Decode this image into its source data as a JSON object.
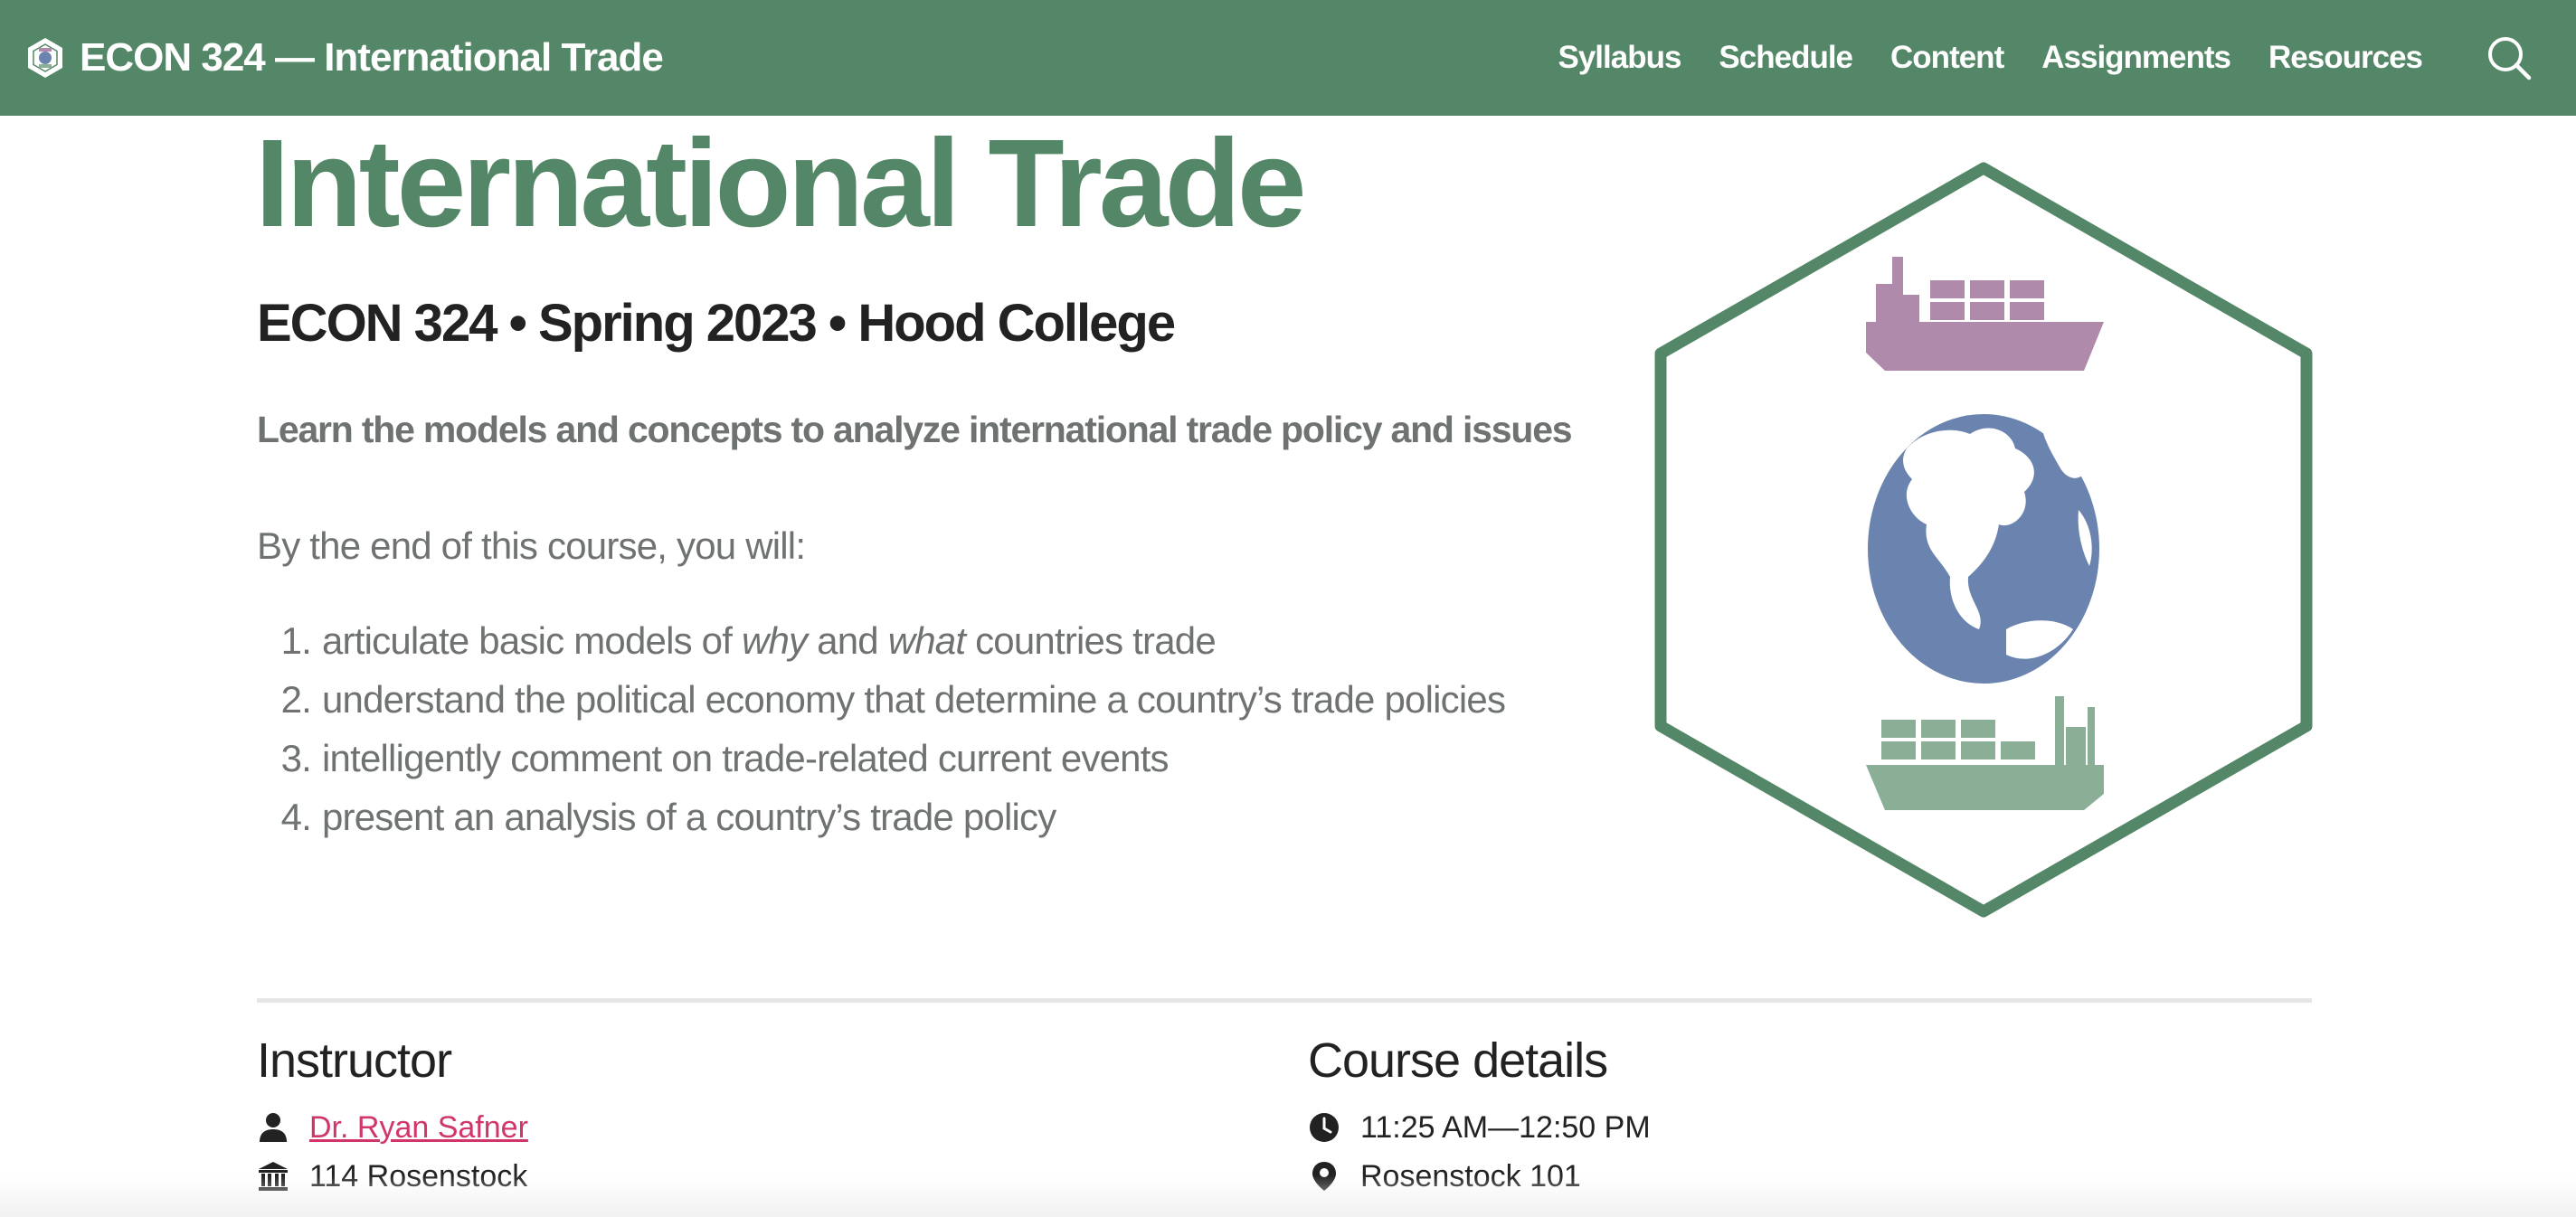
{
  "navbar": {
    "brand_title": "ECON 324 — International Trade",
    "links": [
      "Syllabus",
      "Schedule",
      "Content",
      "Assignments",
      "Resources"
    ],
    "background_color": "#548767",
    "search_icon": "search-icon"
  },
  "hero": {
    "title": "International Trade",
    "subtitle": "ECON 324 • Spring 2023 • Hood College",
    "tagline": "Learn the models and concepts to analyze international trade policy and issues",
    "intro": "By the end of this course, you will:",
    "objectives": [
      {
        "num": "1.",
        "pre": "articulate basic models of ",
        "em1": "why",
        "mid": " and ",
        "em2": "what",
        "post": " countries trade"
      },
      {
        "num": "2.",
        "text": "understand the political economy that determine a country’s trade policies"
      },
      {
        "num": "3.",
        "text": "intelligently comment on trade-related current events"
      },
      {
        "num": "4.",
        "text": "present an analysis of a country’s trade policy"
      }
    ],
    "title_color": "#548767",
    "logo_colors": {
      "hex_border": "#548767",
      "top_ship": "#b08aab",
      "globe": "#6a84af",
      "bottom_ship": "#8aae96"
    }
  },
  "instructor": {
    "heading": "Instructor",
    "name": "Dr. Ryan Safner",
    "office": "114 Rosenstock",
    "name_icon": "person-icon",
    "office_icon": "building-icon",
    "link_color": "#d0366a"
  },
  "course_details": {
    "heading": "Course details",
    "time": "11:25 AM—12:50 PM",
    "location": "Rosenstock 101",
    "time_icon": "clock-icon",
    "location_icon": "map-pin-icon"
  }
}
